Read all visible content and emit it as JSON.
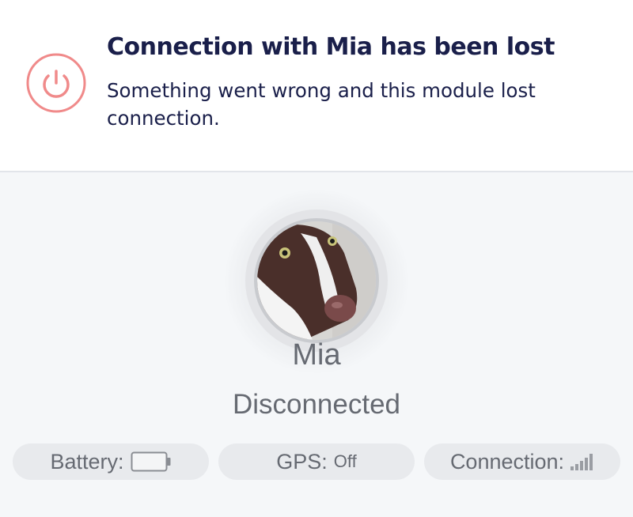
{
  "banner": {
    "title": "Connection with Mia has been lost",
    "message": "Something went wrong and this module lost connection.",
    "icon": "power-icon",
    "icon_color": "#f08a8a"
  },
  "pet": {
    "name": "Mia",
    "status": "Disconnected",
    "avatar_icon": "dog-photo"
  },
  "status_bar": {
    "battery": {
      "label": "Battery:",
      "icon": "battery-empty-icon",
      "level": 0
    },
    "gps": {
      "label": "GPS:",
      "value": "Off"
    },
    "connection": {
      "label": "Connection:",
      "icon": "signal-icon",
      "bars_active": 0
    }
  },
  "colors": {
    "title_text": "#1a1f4a",
    "muted_text": "#666a72",
    "pill_bg": "#e8eaed",
    "page_bg": "#f5f7f9"
  }
}
